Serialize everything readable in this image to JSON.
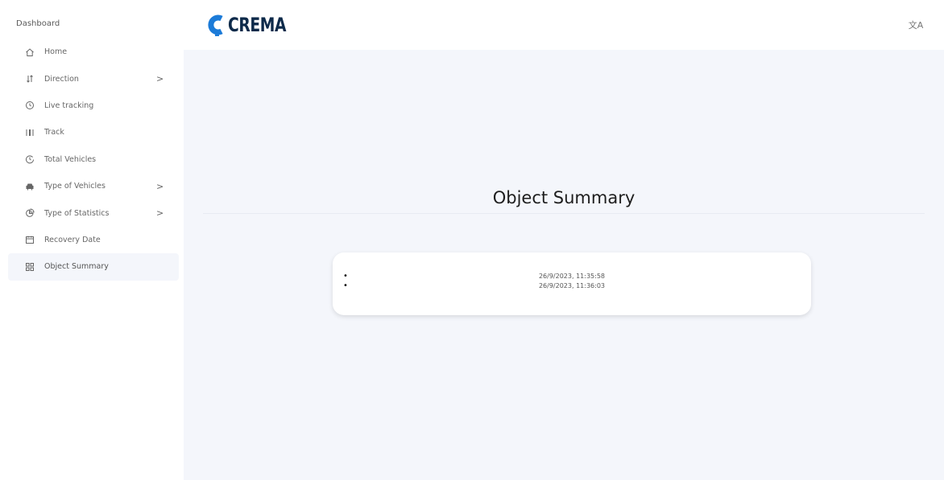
{
  "sidebar": {
    "header": "Dashboard",
    "items": [
      {
        "label": "Home",
        "icon": "home-icon"
      },
      {
        "label": "Direction",
        "icon": "sort-arrows-icon",
        "arrow": ">"
      },
      {
        "label": "Live tracking",
        "icon": "clock-icon"
      },
      {
        "label": "Track",
        "icon": "track-icon"
      },
      {
        "label": "Total Vehicles",
        "icon": "history-icon"
      },
      {
        "label": "Type of Vehicles",
        "icon": "car-icon",
        "arrow": ">"
      },
      {
        "label": "Type of Statistics",
        "icon": "pie-chart-icon",
        "arrow": ">"
      },
      {
        "label": "Recovery Date",
        "icon": "calendar-icon"
      },
      {
        "label": "Object Summary",
        "icon": "grid-icon",
        "active": true
      }
    ]
  },
  "header": {
    "logo_text": "CREMA",
    "translate_icon": "translate-icon",
    "translate_glyph": "文A"
  },
  "main": {
    "title": "Object Summary",
    "summary_items": [
      "26/9/2023, 11:35:58",
      "26/9/2023, 11:36:03"
    ],
    "bullet": "•"
  },
  "colors": {
    "accent": "#1c7bd8",
    "logo_dark": "#0d2a4a",
    "main_bg": "#f4f6fb"
  }
}
